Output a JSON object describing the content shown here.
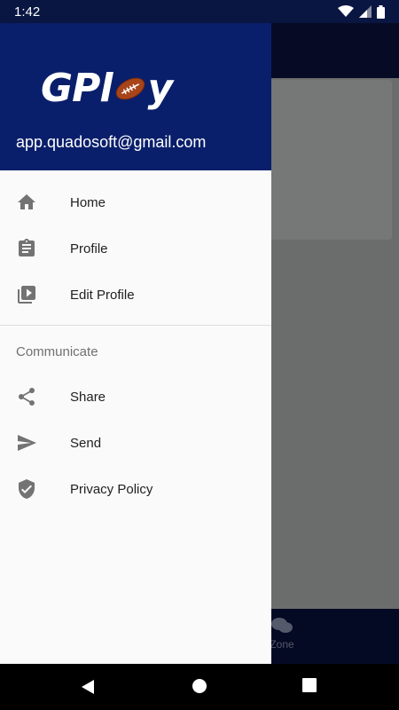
{
  "status_bar": {
    "time": "1:42"
  },
  "drawer": {
    "logo_text": "GPlay",
    "logo_display": "GPl",
    "logo_tail": "y",
    "email": "app.quadosoft@gmail.com",
    "items_primary": [
      {
        "label": "Home",
        "icon": "home-icon"
      },
      {
        "label": "Profile",
        "icon": "clipboard-icon"
      },
      {
        "label": "Edit Profile",
        "icon": "video-library-icon"
      }
    ],
    "section_header": "Communicate",
    "items_secondary": [
      {
        "label": "Share",
        "icon": "share-icon"
      },
      {
        "label": "Send",
        "icon": "send-icon"
      },
      {
        "label": "Privacy Policy",
        "icon": "verified-shield-icon"
      }
    ]
  },
  "background_app": {
    "bottom_nav_label": "Zone"
  },
  "colors": {
    "header": "#0a1f6b",
    "scrim": "#6b6d6d",
    "icon": "#737373"
  }
}
